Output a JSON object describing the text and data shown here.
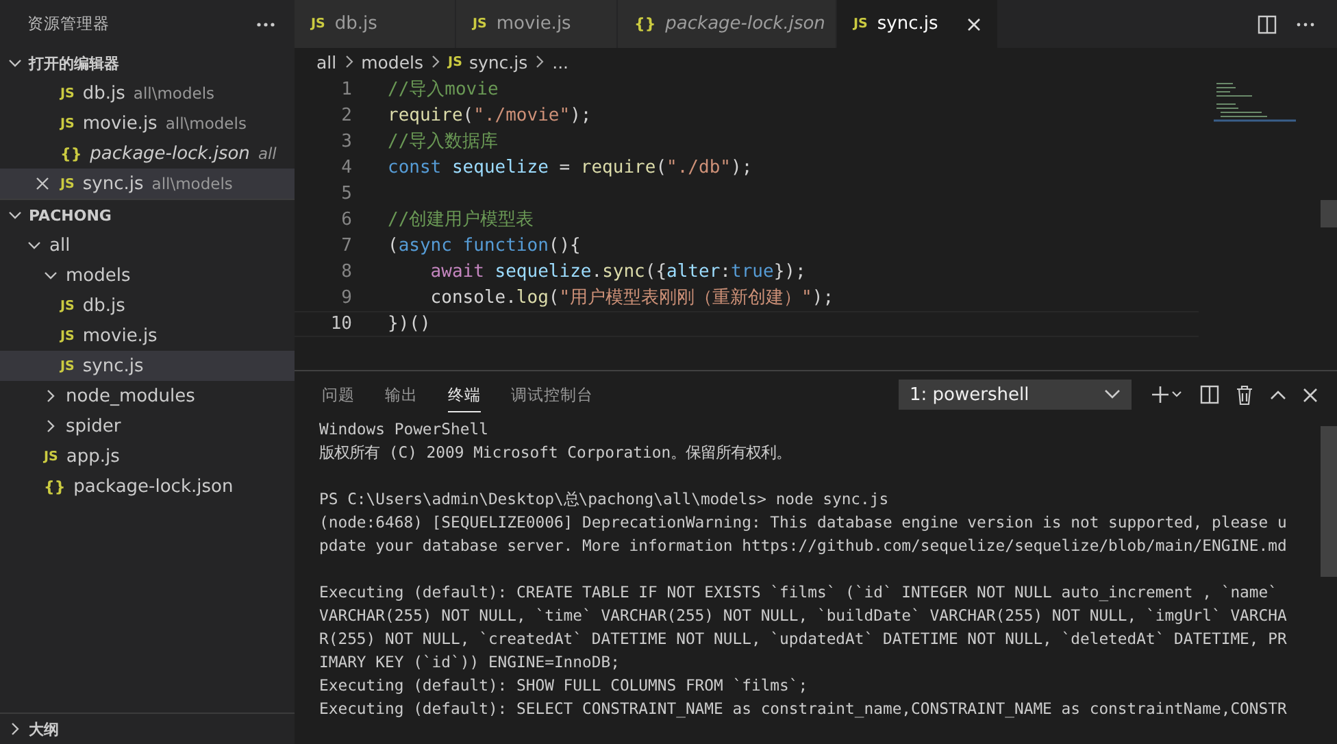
{
  "sidebar": {
    "title": "资源管理器",
    "open_editors": {
      "title": "打开的编辑器",
      "expanded": true,
      "items": [
        {
          "icon": "JS",
          "kind": "js",
          "name": "db.js",
          "path": "all\\models",
          "preview": false,
          "selected": false
        },
        {
          "icon": "JS",
          "kind": "js",
          "name": "movie.js",
          "path": "all\\models",
          "preview": false,
          "selected": false
        },
        {
          "icon": "{}",
          "kind": "json",
          "name": "package-lock.json",
          "path": "all",
          "preview": true,
          "selected": false
        },
        {
          "icon": "JS",
          "kind": "js",
          "name": "sync.js",
          "path": "all\\models",
          "preview": false,
          "selected": true
        }
      ]
    },
    "project": {
      "title": "PACHONG",
      "expanded": true,
      "tree": [
        {
          "name": "all",
          "kind": "folder",
          "expanded": true,
          "selected": false,
          "children": [
            {
              "name": "models",
              "kind": "folder",
              "expanded": true,
              "selected": false,
              "children": [
                {
                  "icon": "JS",
                  "name": "db.js",
                  "kind": "js",
                  "selected": false
                },
                {
                  "icon": "JS",
                  "name": "movie.js",
                  "kind": "js",
                  "selected": false
                },
                {
                  "icon": "JS",
                  "name": "sync.js",
                  "kind": "js",
                  "selected": true
                }
              ]
            },
            {
              "name": "node_modules",
              "kind": "folder",
              "expanded": false,
              "selected": false
            },
            {
              "name": "spider",
              "kind": "folder",
              "expanded": false,
              "selected": false
            },
            {
              "icon": "JS",
              "name": "app.js",
              "kind": "js",
              "selected": false
            },
            {
              "icon": "{}",
              "name": "package-lock.json",
              "kind": "json",
              "selected": false
            }
          ]
        }
      ]
    },
    "outline": {
      "title": "大纲",
      "expanded": false
    }
  },
  "tabs": [
    {
      "icon": "JS",
      "kind": "js",
      "label": "db.js",
      "preview": false,
      "selected": false
    },
    {
      "icon": "JS",
      "kind": "js",
      "label": "movie.js",
      "preview": false,
      "selected": false
    },
    {
      "icon": "{}",
      "kind": "json",
      "label": "package-lock.json",
      "preview": true,
      "selected": false
    },
    {
      "icon": "JS",
      "kind": "js",
      "label": "sync.js",
      "preview": false,
      "selected": true
    }
  ],
  "breadcrumb": [
    {
      "label": "all",
      "kind": "folder"
    },
    {
      "label": "models",
      "kind": "folder"
    },
    {
      "icon": "JS",
      "label": "sync.js",
      "kind": "js"
    },
    {
      "label": "...",
      "kind": "more"
    }
  ],
  "code": [
    {
      "number": "1",
      "selected": false,
      "tokens": [
        {
          "kind": "comment",
          "s": "//导入movie"
        }
      ]
    },
    {
      "number": "2",
      "selected": false,
      "tokens": [
        {
          "kind": "fn",
          "s": "require"
        },
        {
          "kind": "punct",
          "s": "("
        },
        {
          "kind": "str",
          "s": "\"./movie\""
        },
        {
          "kind": "punct",
          "s": ");"
        }
      ]
    },
    {
      "number": "3",
      "selected": false,
      "tokens": [
        {
          "kind": "comment",
          "s": "//导入数据库"
        }
      ]
    },
    {
      "number": "4",
      "selected": false,
      "tokens": [
        {
          "kind": "kw",
          "s": "const "
        },
        {
          "kind": "var",
          "s": "sequelize"
        },
        {
          "kind": "punct",
          "s": " = "
        },
        {
          "kind": "fn",
          "s": "require"
        },
        {
          "kind": "punct",
          "s": "("
        },
        {
          "kind": "str",
          "s": "\"./db\""
        },
        {
          "kind": "punct",
          "s": ");"
        }
      ]
    },
    {
      "number": "5",
      "selected": false
    },
    {
      "number": "6",
      "selected": false,
      "tokens": [
        {
          "kind": "comment",
          "s": "//创建用户模型表"
        }
      ]
    },
    {
      "number": "7",
      "selected": false,
      "tokens": [
        {
          "kind": "punct",
          "s": "("
        },
        {
          "kind": "kw",
          "s": "async function"
        },
        {
          "kind": "punct",
          "s": "(){"
        }
      ]
    },
    {
      "number": "8",
      "selected": false,
      "tokens": [
        {
          "kind": "ctrl",
          "s": "    await "
        },
        {
          "kind": "var",
          "s": "sequelize"
        },
        {
          "kind": "punct",
          "s": "."
        },
        {
          "kind": "fn",
          "s": "sync"
        },
        {
          "kind": "punct",
          "s": "({"
        },
        {
          "kind": "var",
          "s": "alter"
        },
        {
          "kind": "punct",
          "s": ":"
        },
        {
          "kind": "kw",
          "s": "true"
        },
        {
          "kind": "punct",
          "s": "});"
        }
      ]
    },
    {
      "number": "9",
      "selected": false,
      "tokens": [
        {
          "kind": "var2",
          "s": "    console"
        },
        {
          "kind": "punct",
          "s": "."
        },
        {
          "kind": "fn",
          "s": "log"
        },
        {
          "kind": "punct",
          "s": "("
        },
        {
          "kind": "str",
          "s": "\"用户模型表刚刚（重新创建）\""
        },
        {
          "kind": "punct",
          "s": ");"
        }
      ]
    },
    {
      "number": "10",
      "selected": true,
      "tokens": [
        {
          "kind": "punct",
          "s": "})()"
        }
      ]
    }
  ],
  "panel": {
    "tabs": [
      {
        "label": "问题",
        "selected": false
      },
      {
        "label": "输出",
        "selected": false
      },
      {
        "label": "终端",
        "selected": true
      },
      {
        "label": "调试控制台",
        "selected": false
      }
    ],
    "terminal_select": {
      "value": "1: powershell"
    },
    "terminal": [
      [
        "Windows PowerShell",
        "版权所有 (C) 2009 Microsoft Corporation。保留所有权利。"
      ],
      [
        "PS C:\\Users\\admin\\Desktop\\总\\pachong\\all\\models> node sync.js",
        "(node:6468) [SEQUELIZE0006] DeprecationWarning: This database engine version is not supported, please u",
        "pdate your database server. More information https://github.com/sequelize/sequelize/blob/main/ENGINE.md"
      ],
      [
        "Executing (default): CREATE TABLE IF NOT EXISTS `films` (`id` INTEGER NOT NULL auto_increment , `name`",
        "VARCHAR(255) NOT NULL, `time` VARCHAR(255) NOT NULL, `buildDate` VARCHAR(255) NOT NULL, `imgUrl` VARCHA",
        "R(255) NOT NULL, `createdAt` DATETIME NOT NULL, `updatedAt` DATETIME NOT NULL, `deletedAt` DATETIME, PR",
        "IMARY KEY (`id`)) ENGINE=InnoDB;",
        "Executing (default): SHOW FULL COLUMNS FROM `films`;",
        "Executing (default): SELECT CONSTRAINT_NAME as constraint_name,CONSTRAINT_NAME as constraintName,CONSTR"
      ]
    ]
  }
}
